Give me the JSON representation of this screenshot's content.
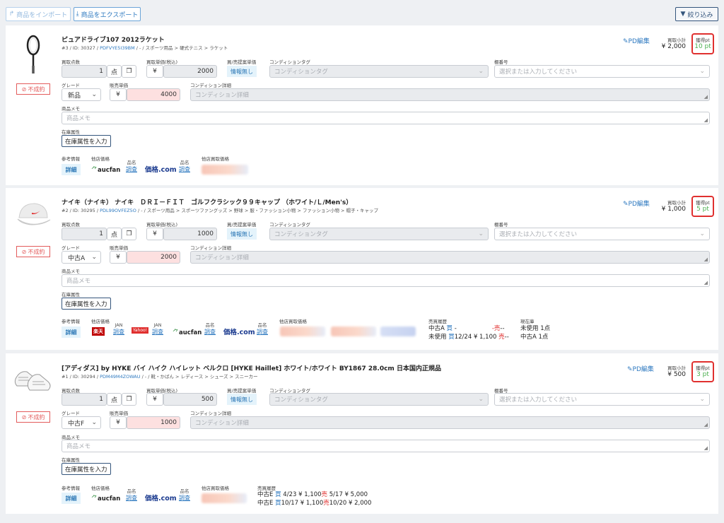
{
  "toolbar": {
    "import_label": "商品をインポート",
    "export_label": "商品をエクスポート",
    "filter_label": "絞り込み"
  },
  "labels": {
    "buy_qty": "買取点数",
    "buy_price": "買取単価(税込)",
    "proposal": "買/売提案単価",
    "condition_tag": "コンディションタグ",
    "shelf": "棚番号",
    "grade": "グレード",
    "sell_price": "販売単価",
    "condition_detail": "コンディション詳細",
    "memo": "商品メモ",
    "stock_attr": "在庫属性",
    "stock_attr_btn": "在庫属性を入力",
    "ref_info": "参考情報",
    "detail": "詳細",
    "other_price": "他店価格",
    "other_buy_price": "他店買取価格",
    "sell_history": "売買履歴",
    "in_stock": "現在庫",
    "no_info": "情報無し",
    "unit": "点",
    "yen": "¥",
    "unsold": "不成約",
    "pd_edit": "PD編集",
    "subtotal": "買取小計",
    "point_label": "獲得pt",
    "condition_tag_ph": "コンディションタグ",
    "shelf_ph": "選択または入力してください",
    "condition_detail_ph": "コンディション詳細",
    "memo_ph": "商品メモ",
    "product_name": "品名",
    "search": "調査",
    "jan": "JAN",
    "aucfan": "aucfan",
    "kakaku": "価格.com",
    "rakuten": "楽天",
    "yahoo": "Yahoo!"
  },
  "items": [
    {
      "title": "ピュアドライブ107 2012ラケット",
      "path_prefix": "#3 / ID: 30327 / ",
      "pd_code": "PDFVYE5I39BM",
      "path_suffix": " / - / スポーツ用品 > 硬式テニス > ラケット",
      "qty": "1",
      "buy_price": "2000",
      "grade": "新品",
      "sell_price": "4000",
      "subtotal": "¥ 2,000",
      "points": "10 pt"
    },
    {
      "title": "ナイキ（ナイキ） ナイキ　ＤＲＩ－ＦＩＴ　ゴルフクラシック９９キャップ （ホワイト/Ｌ/Men's）",
      "path_prefix": "#2 / ID: 30295 / ",
      "pd_code": "PDL99OVFEZ5O",
      "path_suffix": " / - / スポーツ用品 > スポーツファングッズ > 野球 > 服・ファッション小物 > ファッション小物 > 帽子・キャップ",
      "qty": "1",
      "buy_price": "1000",
      "grade": "中古A",
      "sell_price": "2000",
      "subtotal": "¥ 1,000",
      "points": "5 pt",
      "history": [
        {
          "grade": "中古A",
          "kind": "買",
          "date": "-",
          "price": "",
          "kind2": "-売",
          "date2": "-",
          "price2": "-"
        },
        {
          "grade": "未使用",
          "kind": "買",
          "date": "12/24",
          "price": "¥ 1,100",
          "kind2": "売",
          "date2": "-",
          "price2": "-"
        }
      ],
      "stock": [
        "未使用 1点",
        "中古A 1点"
      ]
    },
    {
      "title": "[アディダス] by HYKE バイ ハイク ハイレット ベルクロ [HYKE Haillet] ホワイト/ホワイト BY1867 28.0cm 日本国内正規品",
      "path_prefix": "#1 / ID: 30294 / ",
      "pd_code": "PDM49M4ZOWAU",
      "path_suffix": " / - / 靴・かばん > レディース > シューズ > スニーカー",
      "qty": "1",
      "buy_price": "500",
      "grade": "中古F",
      "sell_price": "1000",
      "subtotal": "¥ 500",
      "points": "3 pt",
      "history": [
        {
          "grade": "中古E",
          "kind": "買",
          "date": "4/23",
          "price": "¥ 1,100",
          "kind2": "売",
          "date2": "5/17",
          "price2": "¥ 5,000"
        },
        {
          "grade": "中古E",
          "kind": "買",
          "date": "10/17",
          "price": "¥ 1,100",
          "kind2": "売",
          "date2": "10/20",
          "price2": "¥ 2,000"
        }
      ]
    }
  ]
}
